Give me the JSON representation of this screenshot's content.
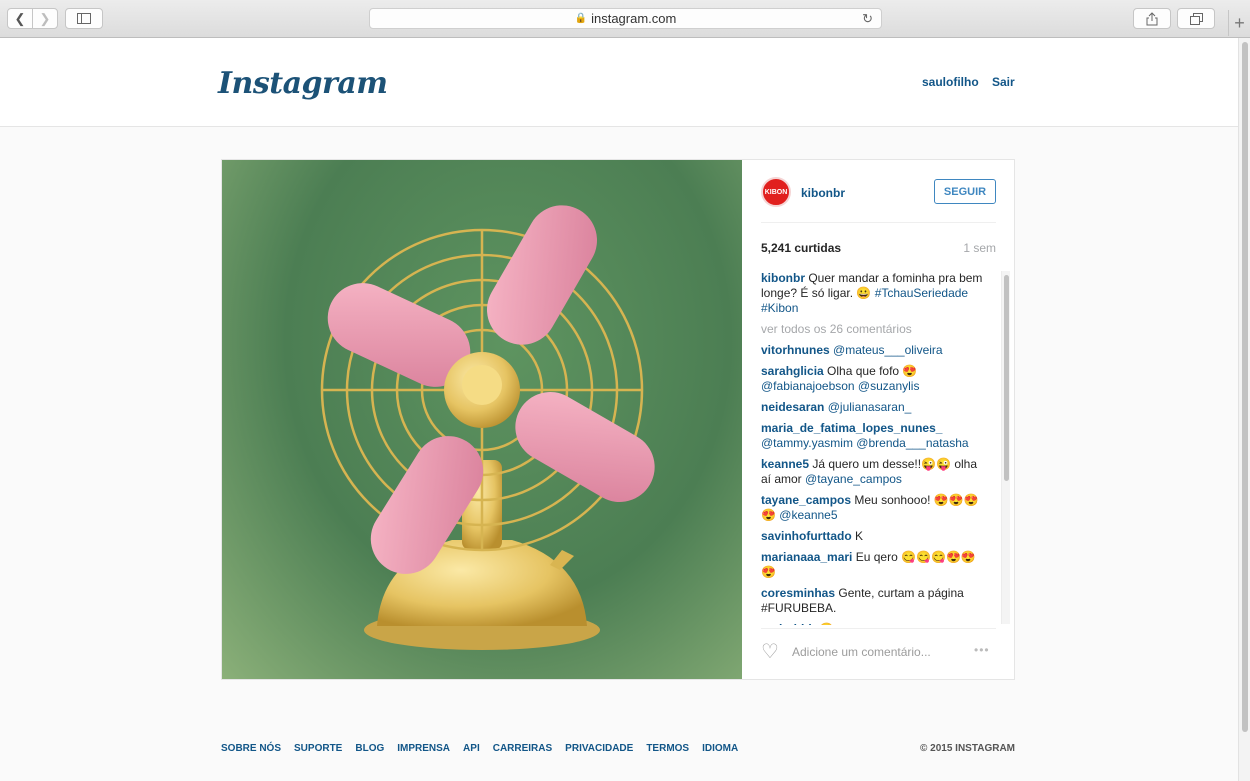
{
  "browser": {
    "url": "instagram.com"
  },
  "header": {
    "logo": "Instagram",
    "username": "saulofilho",
    "logout": "Sair"
  },
  "post": {
    "owner": "kibonbr",
    "avatar_text": "KIBON",
    "follow_label": "SEGUIR",
    "likes": "5,241 curtidas",
    "time": "1 sem",
    "caption": {
      "user": "kibonbr",
      "text": "Quer mandar a fominha pra bem longe? É só ligar. 😀",
      "tags": "#TchauSeriedade #Kibon"
    },
    "view_all": "ver todos os 26 comentários",
    "comments": [
      {
        "user": "vitorhnunes",
        "text": "",
        "mentions": "@mateus___oliveira"
      },
      {
        "user": "sarahglicia",
        "text": "Olha que fofo 😍",
        "mentions": "@fabianajoebson @suzanylis"
      },
      {
        "user": "neidesaran",
        "text": "",
        "mentions": "@julianasaran_"
      },
      {
        "user": "maria_de_fatima_lopes_nunes_",
        "text": "",
        "mentions": "@tammy.yasmim @brenda___natasha"
      },
      {
        "user": "keanne5",
        "text": "Já quero um desse!!😜😜 olha aí amor",
        "mentions": "@tayane_campos"
      },
      {
        "user": "tayane_campos",
        "text": "Meu sonhooo! 😍😍😍😍",
        "mentions": "@keanne5"
      },
      {
        "user": "savinhofurttado",
        "text": "K",
        "mentions": ""
      },
      {
        "user": "marianaaa_mari",
        "text": "Eu qero 😋😋😋😍😍😍",
        "mentions": ""
      },
      {
        "user": "coresminhas",
        "text": "Gente, curtam a página #FURUBEBA.",
        "mentions": ""
      },
      {
        "user": "anderhbb",
        "text": "😍",
        "mentions": ""
      }
    ],
    "comment_placeholder": "Adicione um comentário...",
    "more_label": "•••"
  },
  "footer": {
    "links": [
      "SOBRE NÓS",
      "SUPORTE",
      "BLOG",
      "IMPRENSA",
      "API",
      "CARREIRAS",
      "PRIVACIDADE",
      "TERMOS",
      "IDIOMA"
    ],
    "copyright": "© 2015 INSTAGRAM"
  }
}
